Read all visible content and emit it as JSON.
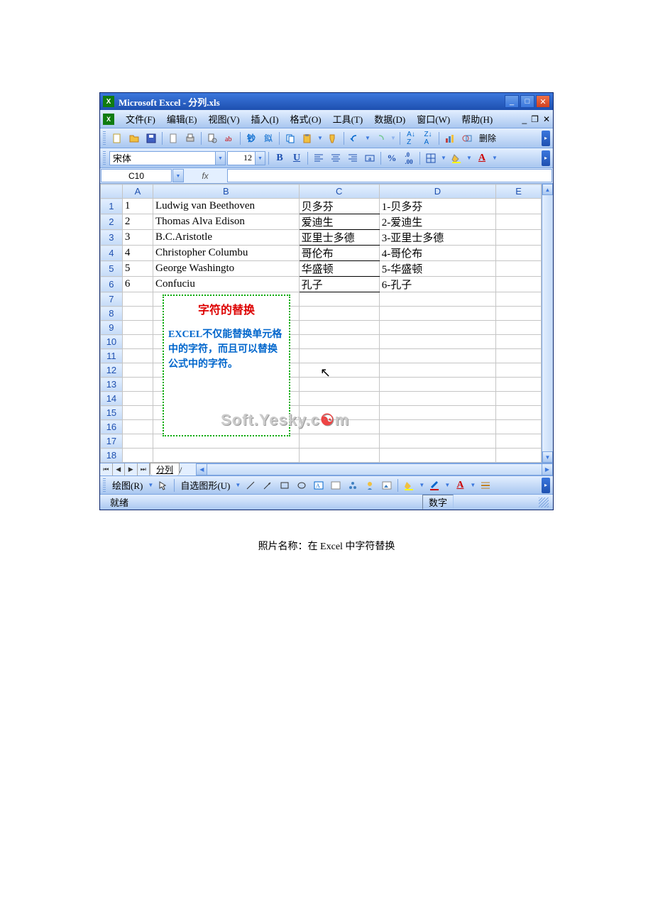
{
  "title": "Microsoft Excel - 分列.xls",
  "menu": {
    "file": "文件(F)",
    "edit": "编辑(E)",
    "view": "视图(V)",
    "insert": "插入(I)",
    "format": "格式(O)",
    "tools": "工具(T)",
    "data": "数据(D)",
    "window": "窗口(W)",
    "help": "帮助(H)"
  },
  "fmt": {
    "font": "宋体",
    "size": "12"
  },
  "toolbar": {
    "delete": "删除"
  },
  "namebox": "C10",
  "fx": "fx",
  "columns": [
    "A",
    "B",
    "C",
    "D",
    "E"
  ],
  "rows": [
    {
      "n": "1",
      "a": "1",
      "b": "Ludwig van Beethoven",
      "c": "贝多芬",
      "d": "1-贝多芬"
    },
    {
      "n": "2",
      "a": "2",
      "b": "Thomas Alva Edison",
      "c": "爱迪生",
      "d": "2-爱迪生"
    },
    {
      "n": "3",
      "a": "3",
      "b": "B.C.Aristotle",
      "c": "亚里士多德",
      "d": "3-亚里士多德"
    },
    {
      "n": "4",
      "a": "4",
      "b": "Christopher Columbu",
      "c": "哥伦布",
      "d": "4-哥伦布"
    },
    {
      "n": "5",
      "a": "5",
      "b": "George Washingto",
      "c": "华盛顿",
      "d": "5-华盛顿"
    },
    {
      "n": "6",
      "a": "6",
      "b": "Confuciu",
      "c": "孔子",
      "d": "6-孔子"
    }
  ],
  "empty_rows": [
    "7",
    "8",
    "9",
    "10",
    "11",
    "12",
    "13",
    "14",
    "15",
    "16",
    "17",
    "18"
  ],
  "callout": {
    "title": "字符的替换",
    "body": "EXCEL不仅能替换单元格中的字符，而且可以替换公式中的字符。"
  },
  "watermark": "Soft.Yesky.c",
  "watermark_suffix": "m",
  "sheet_tab": "分列",
  "draw": {
    "label": "绘图(R)",
    "autoshape": "自选图形(U)"
  },
  "status": {
    "ready": "就绪",
    "mode": "数字"
  },
  "caption": "照片名称：在 Excel 中字符替换"
}
